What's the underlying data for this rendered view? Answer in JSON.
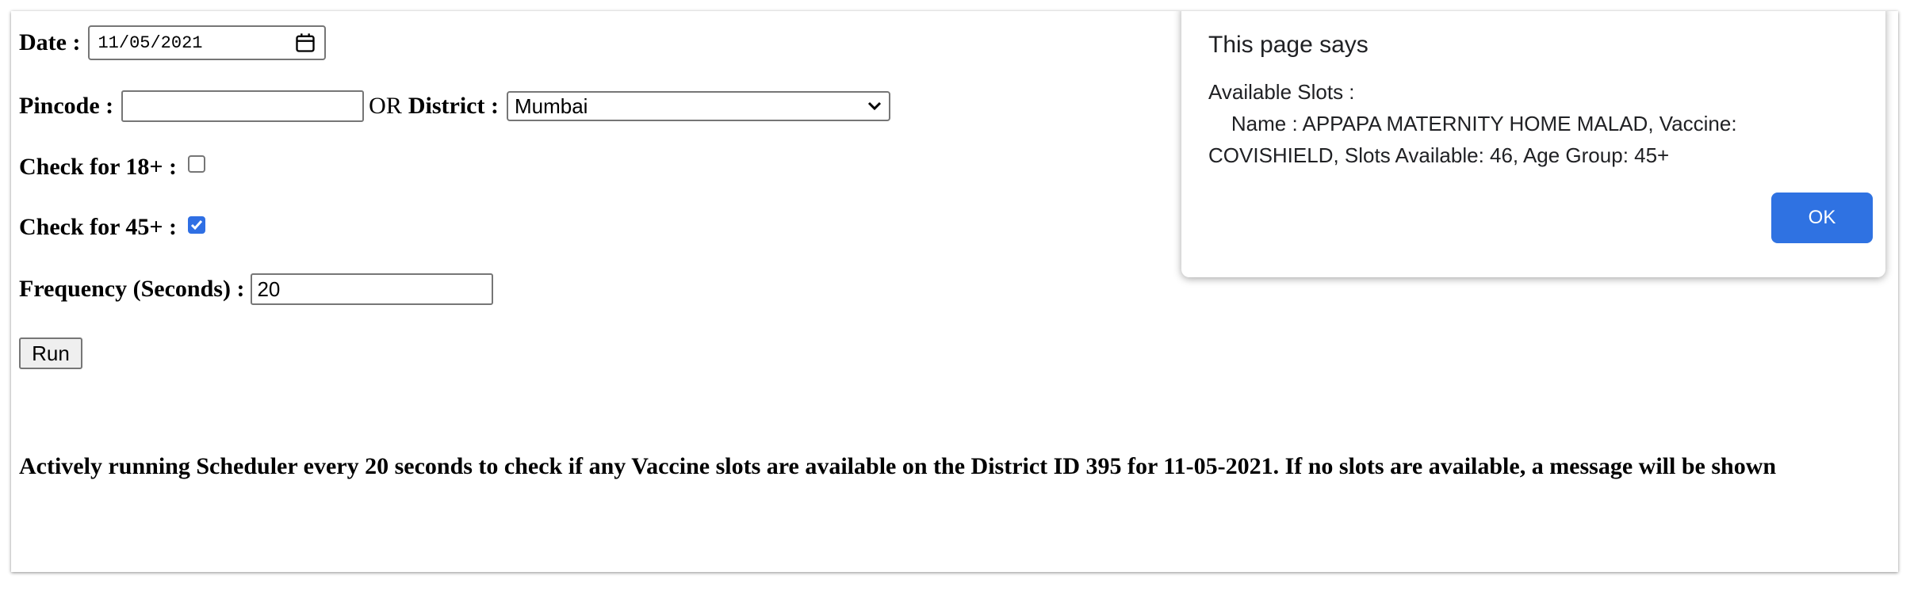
{
  "form": {
    "date_label": "Date :",
    "date_value": "11/05/2021",
    "pincode_label": "Pincode :",
    "pincode_value": "",
    "or_text": "OR",
    "district_label": "District :",
    "district_selected": "Mumbai",
    "check18_label": "Check for 18+ :",
    "check18_checked": false,
    "check45_label": "Check for 45+ :",
    "check45_checked": true,
    "frequency_label": "Frequency (Seconds) :",
    "frequency_value": "20",
    "run_label": "Run"
  },
  "status": {
    "message": "Actively running Scheduler every 20 seconds to check if any Vaccine slots are available on the District ID 395 for 11-05-2021. If no slots are available, a message will be shown"
  },
  "dialog": {
    "title": "This page says",
    "message": "Available Slots :\n\tName : APPAPA MATERNITY HOME MALAD, Vaccine: COVISHIELD, Slots Available: 46, Age Group: 45+",
    "ok_label": "OK"
  },
  "colors": {
    "accent": "#2f72e2",
    "checkbox_checked": "#2f6fe4"
  },
  "icons": {
    "date": "calendar-icon",
    "select": "chevron-down-icon",
    "checkbox": "checkmark-icon"
  }
}
